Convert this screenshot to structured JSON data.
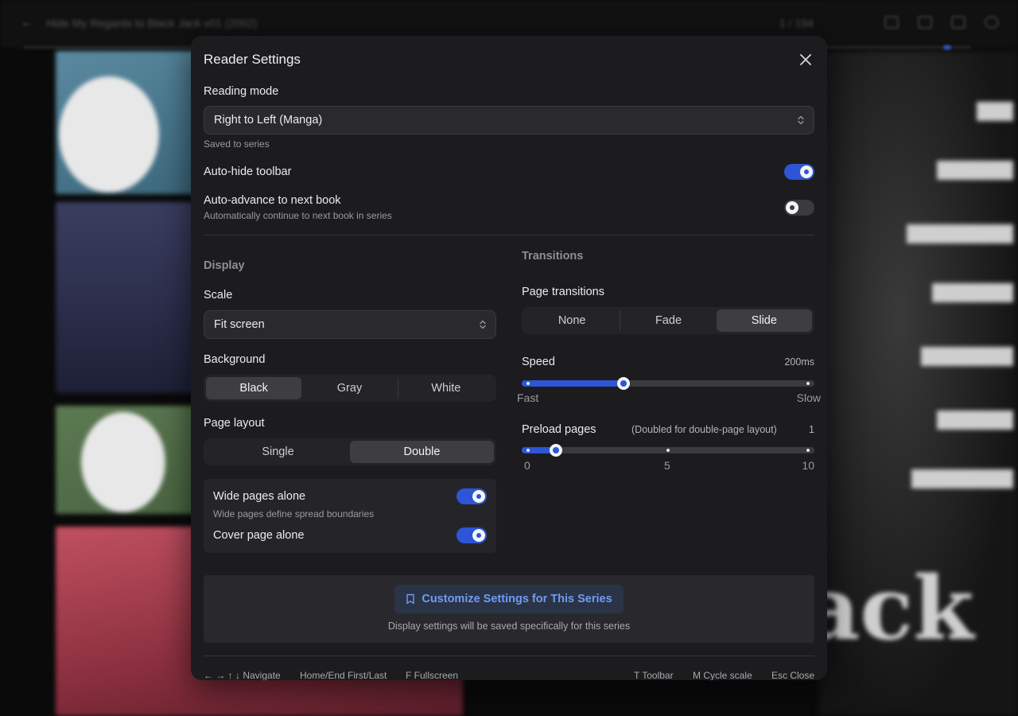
{
  "background": {
    "back_glyph": "←",
    "book_title": "Hide My Regards to Black Jack v01 (2002)",
    "page_indicator": "1 / 194",
    "cover_text": "ack",
    "toolbar_icons": [
      "bookmark-icon",
      "fullscreen-icon",
      "layout-icon",
      "settings-icon"
    ]
  },
  "modal": {
    "title": "Reader Settings",
    "close_glyph": "×"
  },
  "reading_mode": {
    "label": "Reading mode",
    "value": "Right to Left (Manga)",
    "note": "Saved to series"
  },
  "auto_hide_toolbar": {
    "label": "Auto-hide toolbar",
    "enabled": true
  },
  "auto_advance": {
    "label": "Auto-advance to next book",
    "description": "Automatically continue to next book in series",
    "enabled": false
  },
  "display": {
    "section_title": "Display",
    "scale": {
      "label": "Scale",
      "value": "Fit screen"
    },
    "background": {
      "label": "Background",
      "options": [
        "Black",
        "Gray",
        "White"
      ],
      "selected": "Black"
    },
    "page_layout": {
      "label": "Page layout",
      "options": [
        "Single",
        "Double"
      ],
      "selected": "Double"
    },
    "wide_pages_alone": {
      "label": "Wide pages alone",
      "description": "Wide pages define spread boundaries",
      "enabled": true
    },
    "cover_page_alone": {
      "label": "Cover page alone",
      "enabled": true
    }
  },
  "transitions": {
    "section_title": "Transitions",
    "page_transitions": {
      "label": "Page transitions",
      "options": [
        "None",
        "Fade",
        "Slide"
      ],
      "selected": "Slide"
    },
    "speed": {
      "label": "Speed",
      "value_text": "200ms",
      "min_label": "Fast",
      "max_label": "Slow",
      "fraction": 0.34
    },
    "preload": {
      "label": "Preload pages",
      "hint": "(Doubled for double-page layout)",
      "value_text": "1",
      "value": 1,
      "min": 0,
      "max": 10,
      "tick_labels": [
        "0",
        "5",
        "10"
      ]
    }
  },
  "customize": {
    "button_label": "Customize Settings for This Series",
    "note": "Display settings will be saved specifically for this series"
  },
  "shortcuts": {
    "navigate": "← → ↑ ↓ Navigate",
    "home_end": "Home/End First/Last",
    "fullscreen": "F Fullscreen",
    "toolbar": "T Toolbar",
    "cycle_scale": "M Cycle scale",
    "close": "Esc Close"
  }
}
